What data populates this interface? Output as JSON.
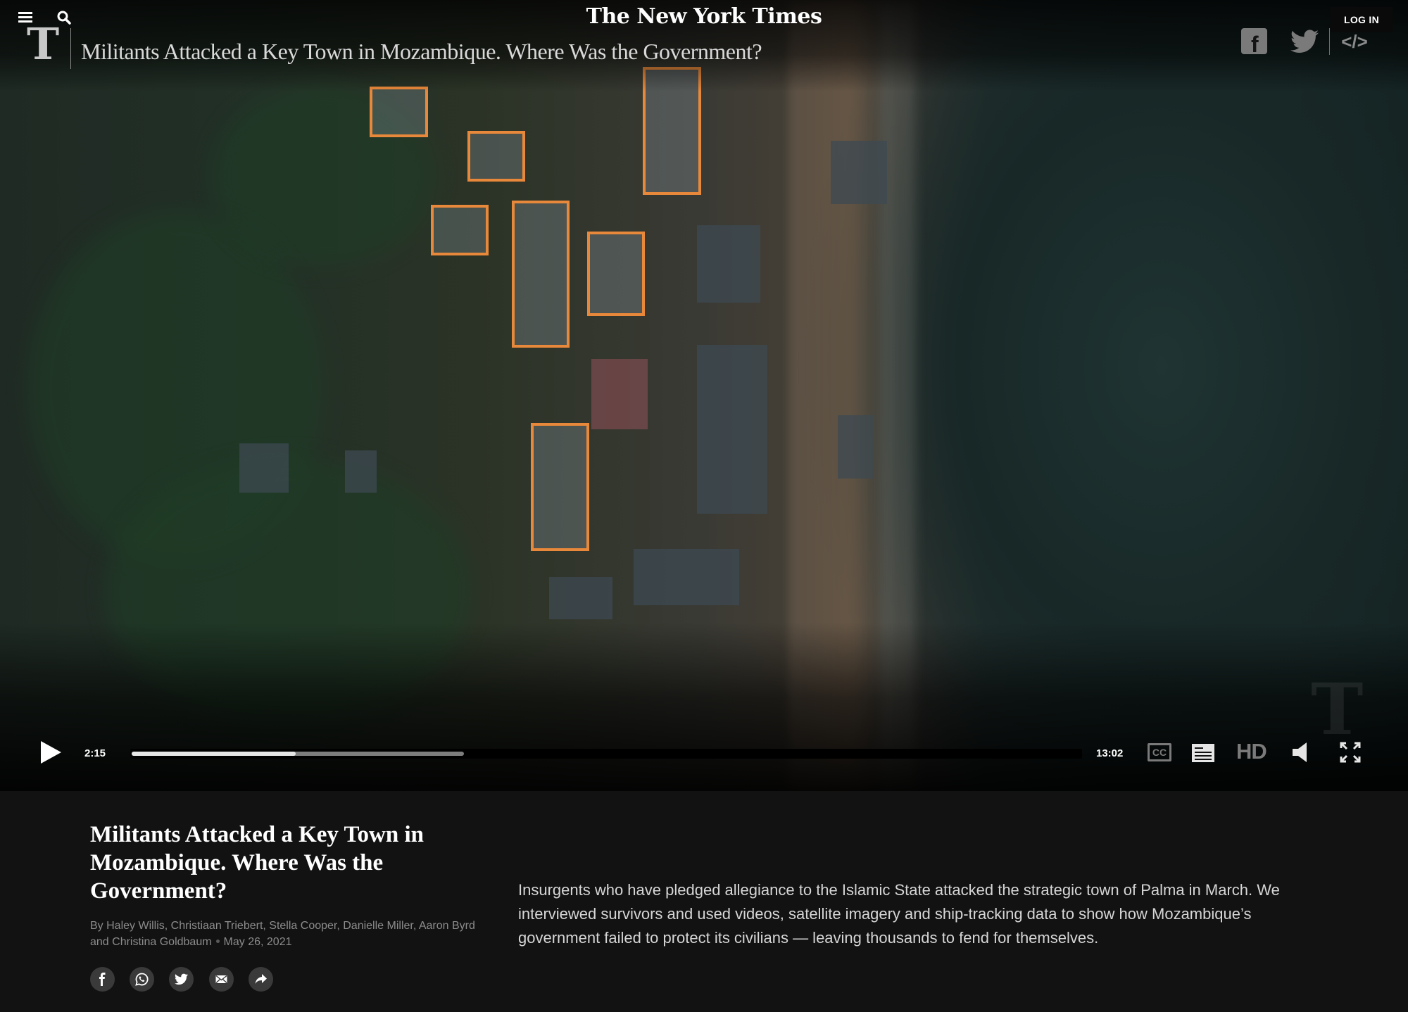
{
  "header": {
    "masthead": "The New York Times",
    "video_title": "Militants Attacked a Key Town in Mozambique. Where Was the Government?",
    "login_label": "LOG IN",
    "logo_glyph": "T",
    "embed_glyph": "</>",
    "facebook_glyph": "f"
  },
  "player": {
    "current_time": "2:15",
    "duration": "13:02",
    "played_fraction": 0.173,
    "buffered_fraction": 0.35,
    "cc_label": "CC",
    "hd_label": "HD",
    "accent_color": "#e8883a"
  },
  "article": {
    "headline": "Militants Attacked a Key Town in Mozambique. Where Was the Government?",
    "byline": "By Haley Willis, Christiaan Triebert, Stella Cooper, Danielle Miller, Aaron Byrd and Christina Goldbaum",
    "date": "May 26, 2021",
    "summary": "Insurgents who have pledged allegiance to the Islamic State attacked the strategic town of Palma in March. We interviewed survivors and used videos, satellite imagery and ship-tracking data to show how Mozambique’s government failed to protect its civilians — leaving thousands to fend for themselves.",
    "share_icons": [
      "facebook-icon",
      "whatsapp-icon",
      "twitter-icon",
      "email-icon",
      "share-arrow-icon"
    ]
  }
}
